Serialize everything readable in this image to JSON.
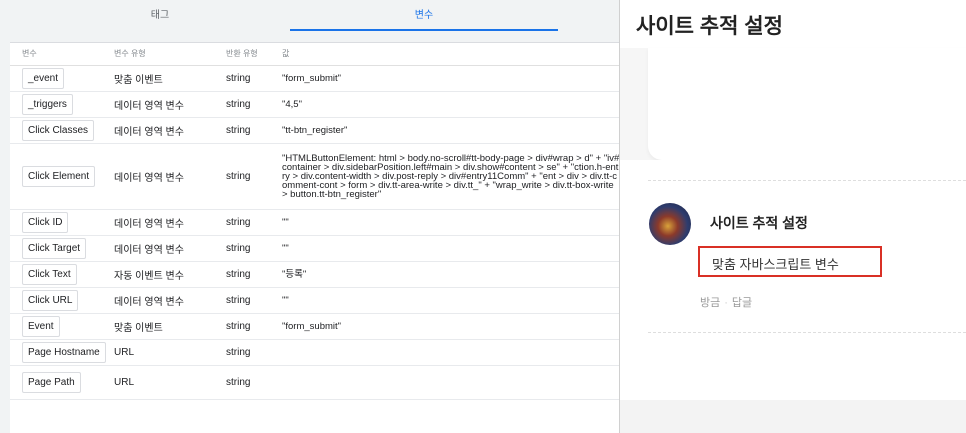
{
  "tabs": {
    "tag_label": "태그",
    "variables_label": "변수"
  },
  "table": {
    "headers": [
      "변수",
      "변수 유형",
      "반환 유형",
      "값"
    ],
    "rows": [
      {
        "name": "_event",
        "type": "맞춤 이벤트",
        "return": "string",
        "value": "\"form_submit\""
      },
      {
        "name": "_triggers",
        "type": "데이터 영역 변수",
        "return": "string",
        "value": "\"4,5\""
      },
      {
        "name": "Click Classes",
        "type": "데이터 영역 변수",
        "return": "string",
        "value": "\"tt-btn_register\""
      },
      {
        "name": "Click Element",
        "type": "데이터 영역 변수",
        "return": "string",
        "value": "\"HTMLButtonElement: html > body.no-scroll#tt-body-page > div#wrap > d\" + \"iv#container > div.sidebarPosition.left#main > div.show#content > se\" + \"ction.h-entry > div.content-width > div.post-reply > div#entry11Comm\" + \"ent > div > div.tt-comment-cont > form > div.tt-area-write > div.tt_\" + \"wrap_write > div.tt-box-write > button.tt-btn_register\""
      },
      {
        "name": "Click ID",
        "type": "데이터 영역 변수",
        "return": "string",
        "value": "\"\""
      },
      {
        "name": "Click Target",
        "type": "데이터 영역 변수",
        "return": "string",
        "value": "\"\""
      },
      {
        "name": "Click Text",
        "type": "자동 이벤트 변수",
        "return": "string",
        "value": "\"등록\""
      },
      {
        "name": "Click URL",
        "type": "데이터 영역 변수",
        "return": "string",
        "value": "\"\""
      },
      {
        "name": "Event",
        "type": "맞춤 이벤트",
        "return": "string",
        "value": "\"form_submit\""
      },
      {
        "name": "Page Hostname",
        "type": "URL",
        "return": "string",
        "value": ""
      },
      {
        "name": "Page Path",
        "type": "URL",
        "return": "string",
        "value": ""
      }
    ]
  },
  "blog": {
    "title": "사이트 추적 설정",
    "comment_author": "사이트 추적 설정",
    "comment_text": "맞춤 자바스크립트 변수",
    "meta_time": "방금",
    "meta_sep": "·",
    "meta_reply": "답글"
  },
  "colors": {
    "accent": "#1a73e8",
    "highlight_box": "#d93025"
  }
}
